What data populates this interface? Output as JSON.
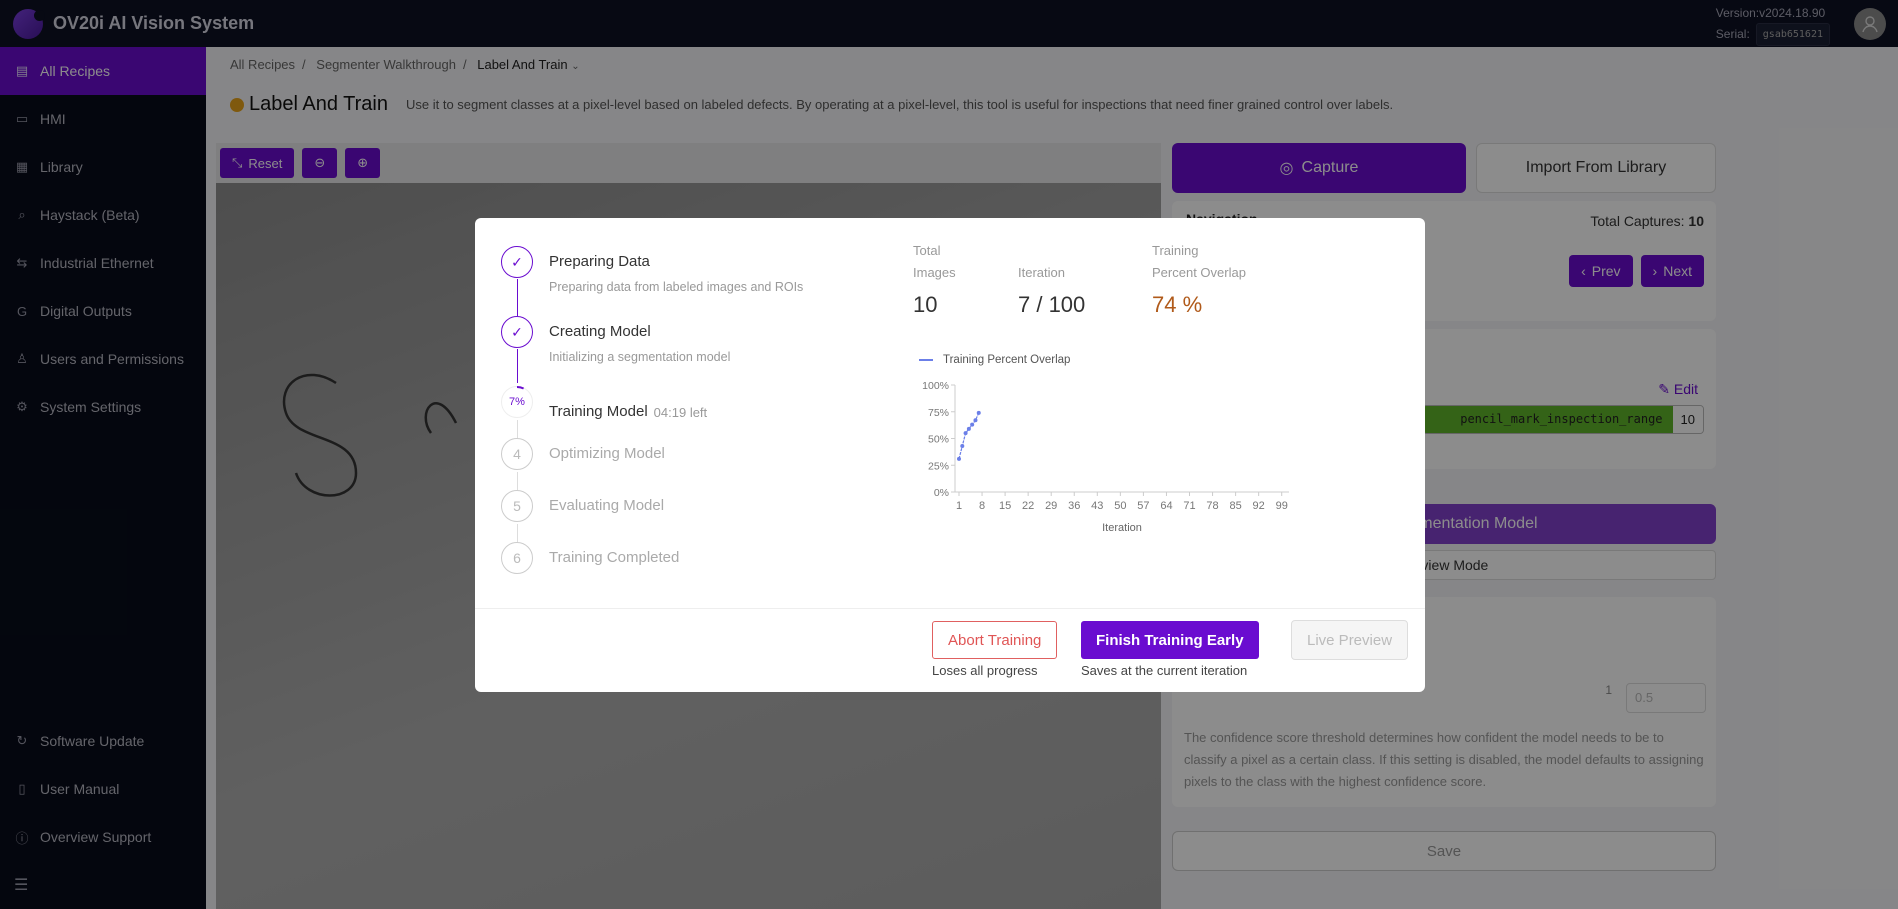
{
  "header": {
    "app_title": "OV20i AI Vision System",
    "version_label": "Version:",
    "version": "v2024.18.90",
    "serial_label": "Serial:",
    "serial": "gsab651621"
  },
  "sidebar": {
    "items": [
      {
        "label": "All Recipes",
        "icon": "recipes-icon",
        "active": true
      },
      {
        "label": "HMI",
        "icon": "hmi-icon"
      },
      {
        "label": "Library",
        "icon": "library-icon"
      },
      {
        "label": "Haystack (Beta)",
        "icon": "search-icon"
      },
      {
        "label": "Industrial Ethernet",
        "icon": "ethernet-icon"
      },
      {
        "label": "Digital Outputs",
        "icon": "outputs-icon"
      },
      {
        "label": "Users and Permissions",
        "icon": "user-icon"
      },
      {
        "label": "System Settings",
        "icon": "gear-icon"
      }
    ],
    "bottom_items": [
      {
        "label": "Software Update",
        "icon": "refresh-icon"
      },
      {
        "label": "User Manual",
        "icon": "book-icon"
      },
      {
        "label": "Overview Support",
        "icon": "info-icon"
      }
    ]
  },
  "breadcrumb": [
    "All Recipes",
    "Segmenter Walkthrough",
    "Label And Train"
  ],
  "page": {
    "title": "Label And Train",
    "description": "Use it to segment classes at a pixel-level based on labeled defects. By operating at a pixel-level, this tool is useful for inspections that need finer grained control over labels.",
    "status_color": "#e8a21a"
  },
  "canvas_toolbar": {
    "reset_label": "Reset"
  },
  "right_panel": {
    "capture_label": "Capture",
    "import_label": "Import From Library",
    "navigation_label": "Navigation",
    "total_captures_label": "Total Captures:",
    "total_captures": "10",
    "prev_label": "Prev",
    "next_label": "Next",
    "edit_label": "Edit",
    "class_name": "pencil_mark_inspection_range",
    "class_count": "10",
    "train_label": "Train Segmentation Model",
    "preview_mode_label": "Preview Mode",
    "slider_max": "1",
    "threshold_value": "0.5",
    "confidence_desc": "The confidence score threshold determines how confident the model needs to be to classify a pixel as a certain class. If this setting is disabled, the model defaults to assigning pixels to the class with the highest confidence score.",
    "save_label": "Save"
  },
  "modal": {
    "steps": [
      {
        "title": "Preparing Data",
        "subtitle": "Preparing data from labeled images and ROIs",
        "state": "done"
      },
      {
        "title": "Creating Model",
        "subtitle": "Initializing a segmentation model",
        "state": "done"
      },
      {
        "title": "Training Model",
        "time_left": "04:19 left",
        "progress": "7%",
        "state": "active"
      },
      {
        "title": "Optimizing Model",
        "number": "4",
        "state": "pending"
      },
      {
        "title": "Evaluating Model",
        "number": "5",
        "state": "pending"
      },
      {
        "title": "Training Completed",
        "number": "6",
        "state": "pending"
      }
    ],
    "stats": [
      {
        "label_line1": "Total",
        "label_line2": "Images",
        "value": "10"
      },
      {
        "label_line1": "",
        "label_line2": "Iteration",
        "value": "7 / 100"
      },
      {
        "label_line1": "Training",
        "label_line2": "Percent Overlap",
        "value": "74 %"
      }
    ],
    "abort_label": "Abort Training",
    "abort_hint": "Loses all progress",
    "finish_label": "Finish Training Early",
    "finish_hint": "Saves at the current iteration",
    "live_preview_label": "Live Preview"
  },
  "chart_data": {
    "type": "line",
    "title": "",
    "legend": [
      "Training Percent Overlap"
    ],
    "legend_position": "top-left",
    "xlabel": "Iteration",
    "ylabel": "",
    "x_ticks": [
      1,
      8,
      15,
      22,
      29,
      36,
      43,
      50,
      57,
      64,
      71,
      78,
      85,
      92,
      99
    ],
    "y_ticks": [
      "0%",
      "25%",
      "50%",
      "75%",
      "100%"
    ],
    "xlim": [
      1,
      100
    ],
    "ylim": [
      0,
      100
    ],
    "series": [
      {
        "name": "Training Percent Overlap",
        "color": "#6b7fe8",
        "x": [
          1,
          2,
          3,
          4,
          5,
          6,
          7
        ],
        "values": [
          31,
          43,
          55,
          59,
          63,
          67,
          74
        ]
      }
    ]
  }
}
